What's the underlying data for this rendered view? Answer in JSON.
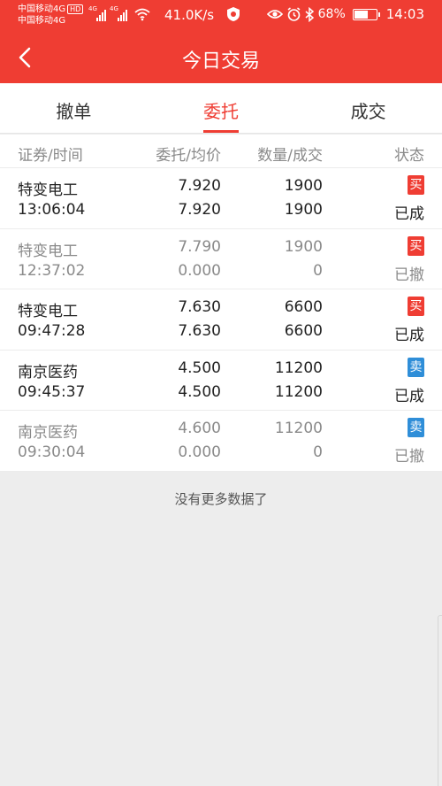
{
  "status_bar": {
    "carrier1": "中国移动4G",
    "hd": "HD",
    "carrier2": "中国移动4G",
    "net1": "4G",
    "net2": "4G",
    "speed": "41.0K/s",
    "battery": "68%",
    "battery_level": 0.68,
    "time": "14:03"
  },
  "header": {
    "title": "今日交易"
  },
  "tabs": [
    {
      "label": "撤单",
      "active": false
    },
    {
      "label": "委托",
      "active": true
    },
    {
      "label": "成交",
      "active": false
    }
  ],
  "table": {
    "columns": [
      "证券/时间",
      "委托/均价",
      "数量/成交",
      "状态"
    ],
    "rows": [
      {
        "name": "特变电工",
        "time": "13:06:04",
        "order_price": "7.920",
        "avg_price": "7.920",
        "quantity": "1900",
        "filled": "1900",
        "side": "买",
        "status": "已成"
      },
      {
        "name": "特变电工",
        "time": "12:37:02",
        "order_price": "7.790",
        "avg_price": "0.000",
        "quantity": "1900",
        "filled": "0",
        "side": "买",
        "status": "已撤"
      },
      {
        "name": "特变电工",
        "time": "09:47:28",
        "order_price": "7.630",
        "avg_price": "7.630",
        "quantity": "6600",
        "filled": "6600",
        "side": "买",
        "status": "已成"
      },
      {
        "name": "南京医药",
        "time": "09:45:37",
        "order_price": "4.500",
        "avg_price": "4.500",
        "quantity": "11200",
        "filled": "11200",
        "side": "卖",
        "status": "已成"
      },
      {
        "name": "南京医药",
        "time": "09:30:04",
        "order_price": "4.600",
        "avg_price": "0.000",
        "quantity": "11200",
        "filled": "0",
        "side": "卖",
        "status": "已撤"
      }
    ]
  },
  "footer": {
    "no_more": "没有更多数据了"
  },
  "colors": {
    "accent": "#ef3d33",
    "buy": "#ef3d33",
    "sell": "#2f8ed8",
    "background": "#ededed"
  },
  "icons": [
    "back-arrow-icon",
    "signal-icon",
    "wifi-icon",
    "shield-icon",
    "eye-icon",
    "alarm-icon",
    "bluetooth-icon",
    "battery-icon"
  ]
}
